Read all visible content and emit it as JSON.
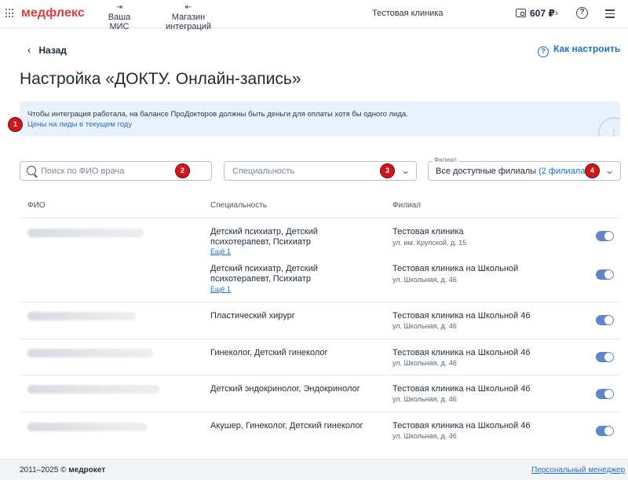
{
  "header": {
    "logo": "медфлекс",
    "nav": [
      {
        "label": "Ваша МИС",
        "icon": "login-arrow-icon"
      },
      {
        "label": "Магазин интеграций",
        "icon": "logout-arrow-icon"
      }
    ],
    "clinic": "Тестовая клиника",
    "balance": "607 ₽"
  },
  "page": {
    "back_label": "Назад",
    "how_setup_label": "Как настроить",
    "title": "Настройка «ДОКТУ. Онлайн-запись»"
  },
  "banner": {
    "text": "Чтобы интеграция работала, на балансе ПроДокторов должны быть деньги для оплаты хотя бы одного лида.",
    "link": "Цены на лиды в текущем году"
  },
  "filters": {
    "search_placeholder": "Поиск по ФИО врача",
    "specialty_placeholder": "Специальность",
    "branch_label": "Филиал",
    "branch_value": "Все доступные филиалы",
    "branch_count": "(2 филиала)"
  },
  "markers": [
    "1",
    "2",
    "3",
    "4"
  ],
  "table": {
    "headers": {
      "name": "ФИО",
      "specialty": "Специальность",
      "branch": "Филиал"
    },
    "rows": [
      {
        "spec1": "Детский психиатр, Детский",
        "spec2": "психотерапевт, Психиатр",
        "more": "Ещё 1",
        "branch": "Тестовая клиника",
        "addr": "ул. им. Крупской, д. 15"
      },
      {
        "spec1": "Детский психиатр, Детский",
        "spec2": "психотерапевт, Психиатр",
        "more": "Ещё 1",
        "branch": "Тестовая клиника на Школьной",
        "addr": "ул. Школьная, д. 46"
      },
      {
        "spec1": "Пластический хирург",
        "branch": "Тестовая клиника на Школьной 46",
        "addr": "ул. Школьная, д. 46"
      },
      {
        "spec1": "Гинеколог, Детский гинеколог",
        "branch": "Тестовая клиника на Школьной 46",
        "addr": "ул. Школьная, д. 46"
      },
      {
        "spec1": "Детский эндокринолог, Эндокринолог",
        "branch": "Тестовая клиника на Школьной 46",
        "addr": "ул. Школьная, д. 46"
      },
      {
        "spec1": "Акушер, Гинеколог, Детский гинеколог",
        "branch": "Тестовая клиника на Школьной 46",
        "addr": "ул. Школьная, д. 46"
      }
    ]
  },
  "footer": {
    "copyright": "2011–2025 © ",
    "brand": "медрокет",
    "manager_link": "Персональный менеджер"
  },
  "colors": {
    "brand": "#e0393e",
    "link": "#1f6fc5",
    "toggle_on": "#5f86c9",
    "marker": "#d0161b"
  }
}
